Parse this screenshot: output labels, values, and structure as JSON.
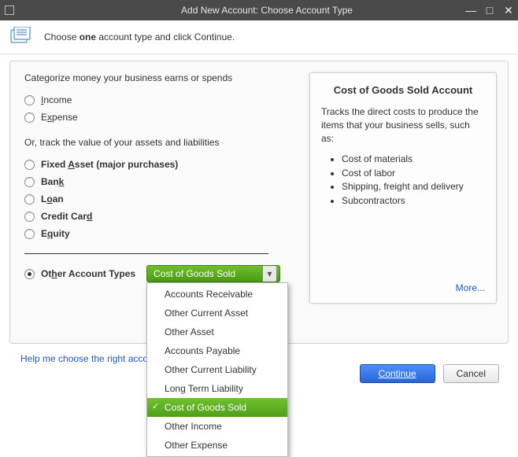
{
  "titlebar": {
    "title": "Add New Account: Choose Account Type"
  },
  "header": {
    "prefix": "Choose ",
    "bold": "one",
    "suffix": " account type and click Continue."
  },
  "sections": {
    "cat1": "Categorize money your business earns or spends",
    "cat2": "Or, track the value of your assets and liabilities"
  },
  "radios": {
    "income": {
      "pre": "",
      "u": "I",
      "post": "ncome"
    },
    "expense": {
      "pre": "E",
      "u": "x",
      "post": "pense"
    },
    "fixed_asset": {
      "pre": "Fixed ",
      "u": "A",
      "post": "sset (major purchases)"
    },
    "bank": {
      "pre": "Ban",
      "u": "k",
      "post": ""
    },
    "loan": {
      "pre": "L",
      "u": "o",
      "post": "an"
    },
    "credit_card": {
      "pre": "Credit Car",
      "u": "d",
      "post": ""
    },
    "equity": {
      "pre": "E",
      "u": "q",
      "post": "uity"
    },
    "other": {
      "pre": "Ot",
      "u": "h",
      "post": "er Account Types"
    }
  },
  "dropdown": {
    "selected": "Cost of Goods Sold",
    "options": [
      "Accounts Receivable",
      "Other Current Asset",
      "Other Asset",
      "Accounts Payable",
      "Other Current Liability",
      "Long Term Liability",
      "Cost of Goods Sold",
      "Other Income",
      "Other Expense"
    ],
    "selected_index": 6
  },
  "info": {
    "title": "Cost of Goods Sold Account",
    "desc": "Tracks the direct costs to produce the items that your business sells, such as:",
    "bullets": [
      "Cost of materials",
      "Cost of labor",
      "Shipping, freight and delivery",
      "Subcontractors"
    ],
    "more": "More..."
  },
  "help_link": "Help me choose the right account type",
  "buttons": {
    "continue": "Continue",
    "cancel": "Cancel"
  }
}
